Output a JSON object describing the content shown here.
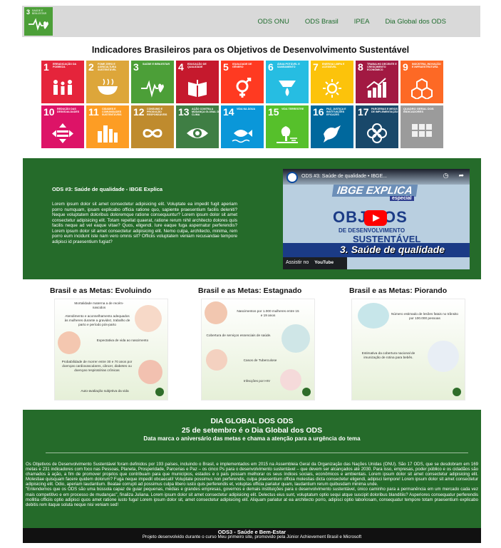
{
  "nav": {
    "logo": {
      "number": "3",
      "text": "SAÚDE E BEM-ESTAR"
    },
    "links": [
      "ODS ONU",
      "ODS Brasil",
      "IPEA",
      "Dia Global dos ODS"
    ]
  },
  "page_title": "Indicadores Brasileiros para os Objetivos de Desenvolvimento Sustentável",
  "sdgs": [
    {
      "num": "1",
      "label": "ERRADICAÇÃO DA POBREZA",
      "color": "#e5243b",
      "icon": "family-icon"
    },
    {
      "num": "2",
      "label": "FOME ZERO E AGRICULTURA SUSTENTÁVEL",
      "color": "#dda63a",
      "icon": "bowl-icon"
    },
    {
      "num": "3",
      "label": "SAÚDE E BEM-ESTAR",
      "color": "#4c9f38",
      "icon": "heartbeat-icon"
    },
    {
      "num": "4",
      "label": "EDUCAÇÃO DE QUALIDADE",
      "color": "#c5192d",
      "icon": "book-icon"
    },
    {
      "num": "5",
      "label": "IGUALDADE DE GÊNERO",
      "color": "#ff3a21",
      "icon": "gender-icon"
    },
    {
      "num": "6",
      "label": "ÁGUA POTÁVEL E SANEAMENTO",
      "color": "#26bde2",
      "icon": "water-icon"
    },
    {
      "num": "7",
      "label": "ENERGIA LIMPA E ACESSÍVEL",
      "color": "#fcc30b",
      "icon": "sun-icon"
    },
    {
      "num": "8",
      "label": "TRABALHO DECENTE E CRESCIMENTO ECONÔMICO",
      "color": "#a21942",
      "icon": "growth-icon"
    },
    {
      "num": "9",
      "label": "INDÚSTRIA, INOVAÇÃO E INFRAESTRUTURA",
      "color": "#fd6925",
      "icon": "cubes-icon"
    },
    {
      "num": "10",
      "label": "REDUÇÃO DAS DESIGUALDADES",
      "color": "#dd1367",
      "icon": "equal-icon"
    },
    {
      "num": "11",
      "label": "CIDADES E COMUNIDADES SUSTENTÁVEIS",
      "color": "#fd9d24",
      "icon": "city-icon"
    },
    {
      "num": "12",
      "label": "CONSUMO E PRODUÇÃO RESPONSÁVEIS",
      "color": "#bf8b2e",
      "icon": "infinity-icon"
    },
    {
      "num": "13",
      "label": "AÇÃO CONTRA A MUDANÇA GLOBAL DO CLIMA",
      "color": "#3f7e44",
      "icon": "eye-globe-icon"
    },
    {
      "num": "14",
      "label": "VIDA NA ÁGUA",
      "color": "#0a97d9",
      "icon": "fish-icon"
    },
    {
      "num": "15",
      "label": "VIDA TERRESTRE",
      "color": "#56c02b",
      "icon": "tree-icon"
    },
    {
      "num": "16",
      "label": "PAZ, JUSTIÇA E INSTITUIÇÕES EFICAZES",
      "color": "#00689d",
      "icon": "dove-icon"
    },
    {
      "num": "17",
      "label": "PARCERIAS E MEIOS DE IMPLEMENTAÇÃO",
      "color": "#19486a",
      "icon": "flower-icon"
    },
    {
      "num": "",
      "label": "QUADRO GERAL DOS INDICADORES",
      "color": "#9b9b9b",
      "icon": "grid-icon"
    }
  ],
  "video": {
    "heading": "ODS #3: Saúde de qualidade - IBGE Explica",
    "text": "Lorem ipsum dolor sit amet consectetur adipisicing elit. Voluptate ea impedit fugit aperiam porro numquam, ipsam explicabo officia ratione quo, sapiente praesentium facilis deleniti? Neque voluptatem doloribus doloremque ratione consequuntur? Lorem ipsum dolor sit amet consectetur adipisicing elit. Totam repellat quaerat, ratione rerum nihil architecto dolores quis facilis neque ad vel eaque vitae? Quos, eligendi. Iure eaque fuga aspernatur perferendis? Lorem ipsum dolor sit amet consectetur adipisicing elit. Nemo culpa, architecto, minima, rem porro eum incidunt iste nam vero omnis sit? Officiis voluptatem veniam recusandae tempore adipisci id praesentium fugiat?",
    "player": {
      "title": "ODS #3: Saúde de qualidade • IBGE...",
      "watch_later": "Assistir mais...",
      "share": "Compartilhar",
      "brand": "IBGE EXPLICA",
      "brand_tag": "especial",
      "big": "OBJ   VOS",
      "sub1": "DE DESENVOLVIMENTO",
      "sub2": "SUSTENTÁVEL",
      "banner": "3. Saúde de qualidade",
      "watch_on": "Assistir no",
      "youtube": "YouTube"
    }
  },
  "metas": [
    {
      "title": "Brasil e as Metas: Evoluindo",
      "items": [
        "Mortalidade materna a de recém-nascidos",
        "Atendimento e aconselhamento adequados às mulheres durante a gravidez, trabalho de parto e período pós-parto",
        "Expectativa de vida ao nascimento",
        "Probabilidade de morrer entre 30 e 70 anos por doenças cardiovasculares, câncer, diabetes ou doenças respiratórias crônicas",
        "Auto-avaliação subjetiva da vida"
      ]
    },
    {
      "title": "Brasil e as Metas: Estagnado",
      "items": [
        "Nascimentos por 1.000 mulheres entre 15 e 19 anos",
        "Cobertura de serviços essenciais de saúde.",
        "Casos de Tuberculose",
        "Infecções por HIV"
      ]
    },
    {
      "title": "Brasil e as Metas: Piorando",
      "items": [
        "Número estimado de lesões fatais no trânsito por 100.000 pessoas",
        "Estimativa da cobertura nacional de imunização de rotina para bebês."
      ]
    }
  ],
  "global": {
    "h1": "DIA GLOBAL DOS ODS",
    "h2": "25 de setembro é o Dia Global dos ODS",
    "h3": "Data marca o aniversário das metas e chama a atenção para a urgência do tema",
    "p1": "Os Objetivos de Desenvolvimento Sustentável foram definidos por 193 países, incluindo o Brasil, e implementados em 2015 na Assembleia Geral da Organização das Nações Unidas (ONU). São 17 ODS, que se desdobram em 169 metas e 231 indicadores com foco nas Pessoas, Planeta, Prosperidade, Parcerias e Paz – os cinco Ps para o desenvolvimento sustentável – que devem ser alcançados até 2030. Para isso, empresas, poder público e os cidadãos são chamados à ação, a fim de promover projetos que contribuam para que municípios, estados e o país possam melhorar os seus índices sociais, econômicos e ambientais. Lorem ipsum dolor sit amet consectetur adipisicing elit. Molestiae quisquam facere quidem dolorum? Fuga neque impedit obcaecati! Voluptate possimus non perferendis, culpa praesentium officia molestias dicta consectetur eligendi, adipisci tempore! Lorem ipsum dolor sit amet consectetur adipisicing elit. Odio, aperiam laudantium. Beatae corrupti ad possimus culpa libero iusto quis perferendis et, voluptas officia pariatur quam, laudantium rerum quibusdam minima unde.",
    "p2": "\"Entendemos que os ODS são uma bússola capaz de guiar pequenas, médias e grandes empresas, governos e demais instituições para o desenvolvimento sustentável, único caminho para a permanência em um mercado cada vez mais competitivo e em processo de mudanças\", finaliza Juliana. Lorem ipsum dolor sit amet consectetur adipisicing elit. Delectus eius sunt, voluptatum optio sequi atque suscipit doloribus blanditiis? Asperiores consequatur perferendis mollitia officiis optio adipisci quos amet ratione iusto fuga! Lorem ipsum dolor sit, amet consectetur adipisicing elit. Aliquam pariatur at ea architecto porro, adipisci optio laboriosam, consequatur tempore totam praesentium explicabo debitis rem itaque soluta neque nisi veniam sed!"
  },
  "footer": {
    "title": "ODS3 - Saúde e Bem-Estar",
    "sub": "Projeto desenvolvido durante o curso Meu primeiro site, promovido pela Júnior Achievement Brasil e Microsoft"
  }
}
